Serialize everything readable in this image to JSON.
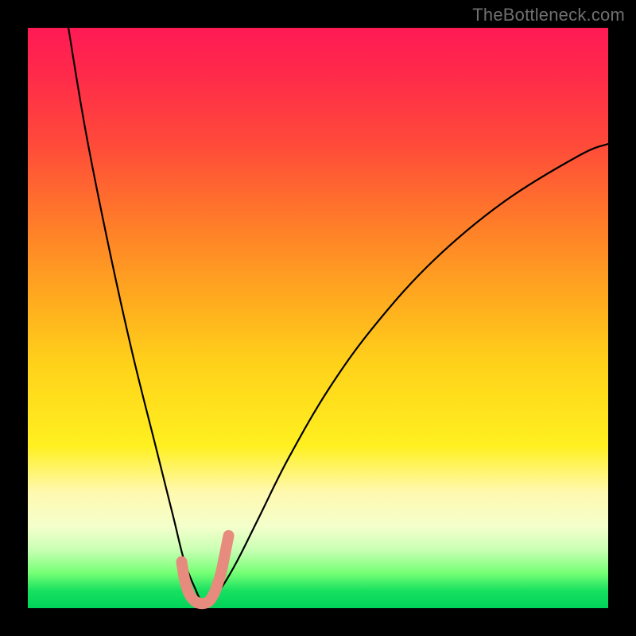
{
  "watermark": "TheBottleneck.com",
  "chart_data": {
    "type": "line",
    "title": "",
    "xlabel": "",
    "ylabel": "",
    "xlim": [
      0,
      100
    ],
    "ylim": [
      0,
      100
    ],
    "grid": false,
    "legend": false,
    "series": [
      {
        "name": "bottleneck-curve",
        "color": "#000000",
        "x": [
          7,
          10,
          14,
          18,
          22,
          25,
          27,
          29,
          30,
          31,
          33,
          36,
          40,
          45,
          52,
          60,
          70,
          82,
          95,
          100
        ],
        "y": [
          100,
          82,
          62,
          44,
          28,
          16,
          8,
          3,
          1,
          1,
          3,
          8,
          16,
          26,
          38,
          49,
          60,
          70,
          78,
          80
        ]
      },
      {
        "name": "trough-highlight",
        "color": "#e78b7e",
        "x": [
          26.5,
          27.0,
          27.8,
          28.8,
          30.0,
          31.2,
          32.2,
          33.2,
          33.8,
          34.3,
          34.6
        ],
        "y": [
          8.0,
          5.0,
          2.5,
          1.2,
          0.8,
          1.2,
          2.8,
          5.8,
          8.5,
          11.0,
          12.5
        ]
      }
    ],
    "colors": {
      "gradient_top": "#ff1a55",
      "gradient_mid": "#ffd21a",
      "gradient_bottom": "#00d45a",
      "curve": "#000000",
      "highlight": "#e78b7e",
      "frame": "#000000"
    }
  }
}
